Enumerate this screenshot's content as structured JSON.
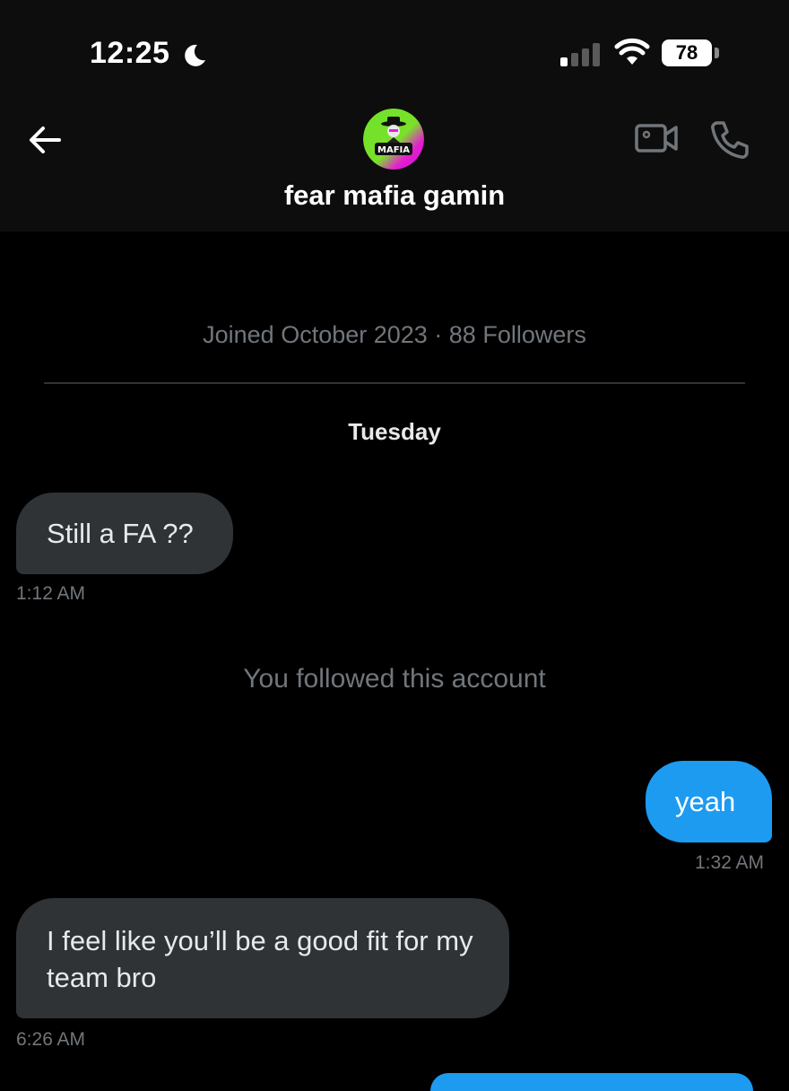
{
  "status_bar": {
    "time": "12:25",
    "battery": "78",
    "icons": [
      "moon-icon",
      "cellular-signal-icon",
      "wifi-icon",
      "battery-icon"
    ]
  },
  "header": {
    "back_icon": "arrow-left-icon",
    "avatar_text": "FEAR MAFIA",
    "name": "fear mafia gamin",
    "actions": [
      "video-call-icon",
      "phone-icon"
    ],
    "colors": {
      "avatar_green": "#6ee32b",
      "avatar_magenta": "#e61ed0"
    }
  },
  "profile_info": {
    "joined": "Joined October 2023 · 88 Followers"
  },
  "conversation": {
    "day_label": "Tuesday",
    "messages": [
      {
        "direction": "incoming",
        "text": "Still a FA ??",
        "time": "1:12 AM"
      },
      {
        "direction": "system",
        "text": "You followed this account"
      },
      {
        "direction": "outgoing",
        "text": "yeah",
        "time": "1:32 AM"
      },
      {
        "direction": "incoming",
        "text": "I feel like you’ll be a good fit for my team bro",
        "time": "6:26 AM"
      }
    ]
  },
  "colors": {
    "background": "#000000",
    "header_bg": "#0d0d0d",
    "incoming_bubble": "#2f3336",
    "outgoing_bubble": "#1d9bf0",
    "secondary_text": "#71767b"
  }
}
